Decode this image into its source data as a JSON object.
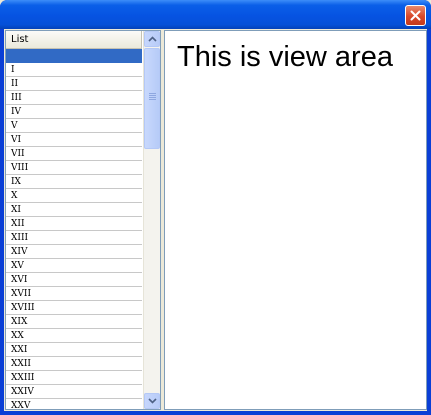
{
  "window": {
    "title": ""
  },
  "list": {
    "header": "List",
    "selected_index": 0,
    "items": [
      "",
      "I",
      "II",
      "III",
      "IV",
      "V",
      "VI",
      "VII",
      "VIII",
      "IX",
      "X",
      "XI",
      "XII",
      "XIII",
      "XIV",
      "XV",
      "XVI",
      "XVII",
      "XVIII",
      "XIX",
      "XX",
      "XXI",
      "XXII",
      "XXIII",
      "XXIV",
      "XXV"
    ]
  },
  "view": {
    "text": "This is view area"
  },
  "icons": {
    "close": "close-icon",
    "scroll_up": "chevron-up-icon",
    "scroll_down": "chevron-down-icon"
  },
  "colors": {
    "titlebar": "#0653e2",
    "selection": "#316ac5",
    "close_button": "#d8482a"
  }
}
